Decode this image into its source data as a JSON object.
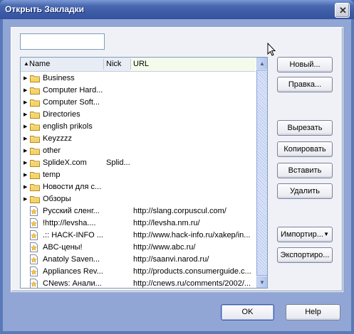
{
  "window": {
    "title": "Открыть Закладки"
  },
  "search": {
    "value": ""
  },
  "list": {
    "columns": {
      "name": "Name",
      "nick": "Nick",
      "url": "URL"
    },
    "folders": [
      {
        "name": "Business",
        "nick": ""
      },
      {
        "name": "Computer Hard...",
        "nick": ""
      },
      {
        "name": "Computer Soft...",
        "nick": ""
      },
      {
        "name": "Directories",
        "nick": ""
      },
      {
        "name": "english prikols",
        "nick": ""
      },
      {
        "name": "Keyzzzz",
        "nick": ""
      },
      {
        "name": "other",
        "nick": ""
      },
      {
        "name": "SplideX.com",
        "nick": "Splid..."
      },
      {
        "name": "temp",
        "nick": ""
      },
      {
        "name": "Новости для с...",
        "nick": ""
      },
      {
        "name": "Обзоры",
        "nick": ""
      }
    ],
    "bookmarks": [
      {
        "name": "Русский сленг...",
        "url": "http://slang.corpuscul.com/"
      },
      {
        "name": "!http://levsha....",
        "url": "http://levsha.nm.ru/"
      },
      {
        "name": ".:: HACK-INFO ...",
        "url": "http://www.hack-info.ru/xakep/in..."
      },
      {
        "name": "ABC-цены!",
        "url": "http://www.abc.ru/"
      },
      {
        "name": "Anatoly Saven...",
        "url": "http://saanvi.narod.ru/"
      },
      {
        "name": "Appliances Rev...",
        "url": "http://products.consumerguide.c..."
      },
      {
        "name": "CNews: Анали...",
        "url": "http://cnews.ru/comments/2002/..."
      }
    ]
  },
  "buttons": {
    "new": "Новый...",
    "edit": "Правка...",
    "cut": "Вырезать",
    "copy": "Копировать",
    "paste": "Вставить",
    "delete": "Удалить",
    "import": "Импортир...",
    "export": "Экспортиро...",
    "ok": "OK",
    "help": "Help"
  },
  "icons": {
    "close": "close-icon",
    "folder": "folder-icon",
    "bookmark": "bookmark-icon",
    "expander": "triangle-right-icon",
    "sort": "sort-arrow-icon",
    "dropdown": "chevron-down-icon",
    "cursor": "mouse-pointer-icon"
  },
  "colors": {
    "titlebar": "#3c5aa4",
    "client": "#91a6d4",
    "panel": "#eff1f7",
    "folder": "#f5d36a"
  }
}
